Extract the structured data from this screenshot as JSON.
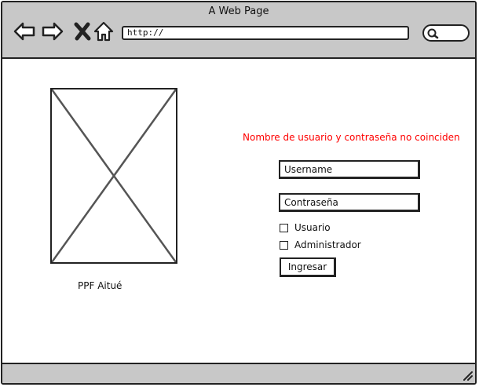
{
  "window": {
    "title": "A Web Page"
  },
  "browser": {
    "address": "http://",
    "icons": {
      "back": "back-arrow-icon",
      "forward": "forward-arrow-icon",
      "stop": "close-icon",
      "home": "home-icon",
      "search": "search-icon"
    }
  },
  "content": {
    "caption": "PPF Aitué",
    "error_message": "Nombre de usuario y contraseña no coinciden",
    "error_color": "#ff0000",
    "username_placeholder": "Username",
    "password_placeholder": "Contraseña",
    "checkboxes": [
      {
        "label": "Usuario",
        "checked": false
      },
      {
        "label": "Administrador",
        "checked": false
      }
    ],
    "submit_label": "Ingresar"
  }
}
